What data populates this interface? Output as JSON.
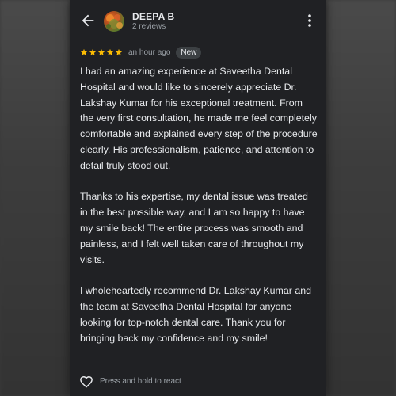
{
  "reviewer": {
    "name": "DEEPA B",
    "review_count": "2 reviews"
  },
  "review": {
    "rating": 5,
    "max_rating": 5,
    "time": "an hour ago",
    "badge": "New",
    "paragraphs": [
      "I had an amazing experience at Saveetha Dental Hospital and would like to sincerely appreciate Dr. Lakshay Kumar for his exceptional treatment. From the very first consultation, he made me feel completely comfortable and explained every step of the procedure clearly. His professionalism, patience, and attention to detail truly stood out.",
      "Thanks to his expertise, my dental issue was treated in the best possible way, and I am so happy to have my smile back! The entire process was smooth and painless, and I felt well taken care of throughout my visits.",
      "I wholeheartedly recommend Dr. Lakshay Kumar and the team at Saveetha Dental Hospital for anyone looking for top-notch dental care. Thank you for bringing back my confidence and my smile!"
    ]
  },
  "react": {
    "label": "Press and hold to react"
  },
  "colors": {
    "background": "#202124",
    "star": "#fbbc04",
    "text": "#e8eaed",
    "muted": "#9aa0a6",
    "badge_bg": "#3c4043"
  },
  "icons": {
    "back": "arrow-left-icon",
    "more": "more-vertical-icon",
    "star": "star-icon",
    "react": "heart-outline-icon"
  }
}
